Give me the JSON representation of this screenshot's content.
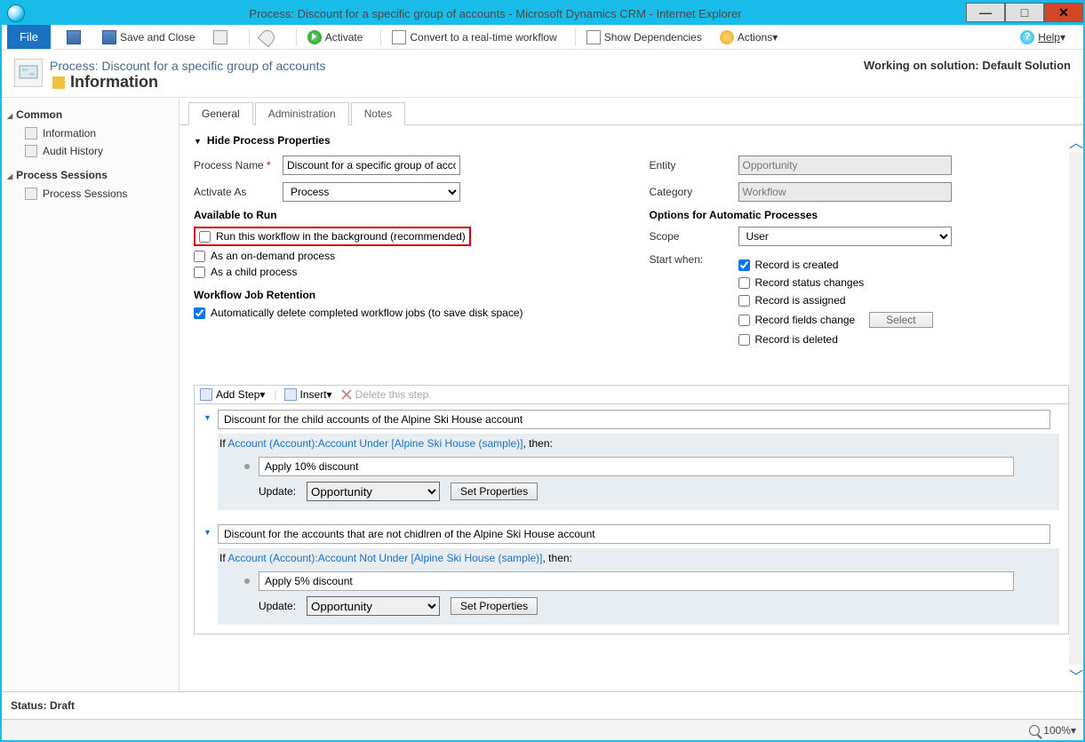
{
  "titlebar": {
    "title": "Process: Discount for a specific group of accounts - Microsoft Dynamics CRM - Internet Explorer"
  },
  "toolbar": {
    "file": "File",
    "save_and_close": "Save and Close",
    "activate": "Activate",
    "convert": "Convert to a real-time workflow",
    "show_deps": "Show Dependencies",
    "actions": "Actions",
    "help": "Help"
  },
  "header": {
    "breadcrumb": "Process: Discount for a specific group of accounts",
    "info": "Information",
    "solution": "Working on solution: Default Solution"
  },
  "nav": {
    "common": "Common",
    "common_items": {
      "info": "Information",
      "audit": "Audit History"
    },
    "sessions_head": "Process Sessions",
    "sessions_item": "Process Sessions"
  },
  "tabs": {
    "general": "General",
    "admin": "Administration",
    "notes": "Notes"
  },
  "form": {
    "hide_props": "Hide Process Properties",
    "process_name_label": "Process Name",
    "process_name_value": "Discount for a specific group of accounts",
    "activate_as_label": "Activate As",
    "activate_as_value": "Process",
    "available_to_run": "Available to Run",
    "run_bg": "Run this workflow in the background (recommended)",
    "on_demand": "As an on-demand process",
    "child_process": "As a child process",
    "wf_retention": "Workflow Job Retention",
    "auto_delete": "Automatically delete completed workflow jobs (to save disk space)",
    "entity_label": "Entity",
    "entity_value": "Opportunity",
    "category_label": "Category",
    "category_value": "Workflow",
    "options_auto": "Options for Automatic Processes",
    "scope_label": "Scope",
    "scope_value": "User",
    "start_when_label": "Start when:",
    "rec_created": "Record is created",
    "status_changes": "Record status changes",
    "rec_assigned": "Record is assigned",
    "fields_change": "Record fields change",
    "select_btn": "Select",
    "rec_deleted": "Record is deleted"
  },
  "sb": {
    "add_step": "Add Step",
    "insert": "Insert",
    "delete_step": "Delete this step.",
    "block1_title": "Discount for the child accounts of the Alpine Ski House account",
    "block1_if_pre": "If ",
    "block1_cond": "Account (Account):Account Under [Alpine Ski House (sample)]",
    "block1_then": ", then:",
    "block1_step": "Apply 10% discount",
    "update_label": "Update:",
    "update_entity": "Opportunity",
    "set_props": "Set Properties",
    "block2_title": "Discount for the accounts that are not chidlren of the Alpine Ski House account",
    "block2_if_pre": "If ",
    "block2_cond": "Account (Account):Account Not Under [Alpine Ski House (sample)]",
    "block2_then": ", then:",
    "block2_step": "Apply 5% discount"
  },
  "status": {
    "label": "Status: Draft"
  },
  "ie": {
    "zoom": "100%"
  }
}
